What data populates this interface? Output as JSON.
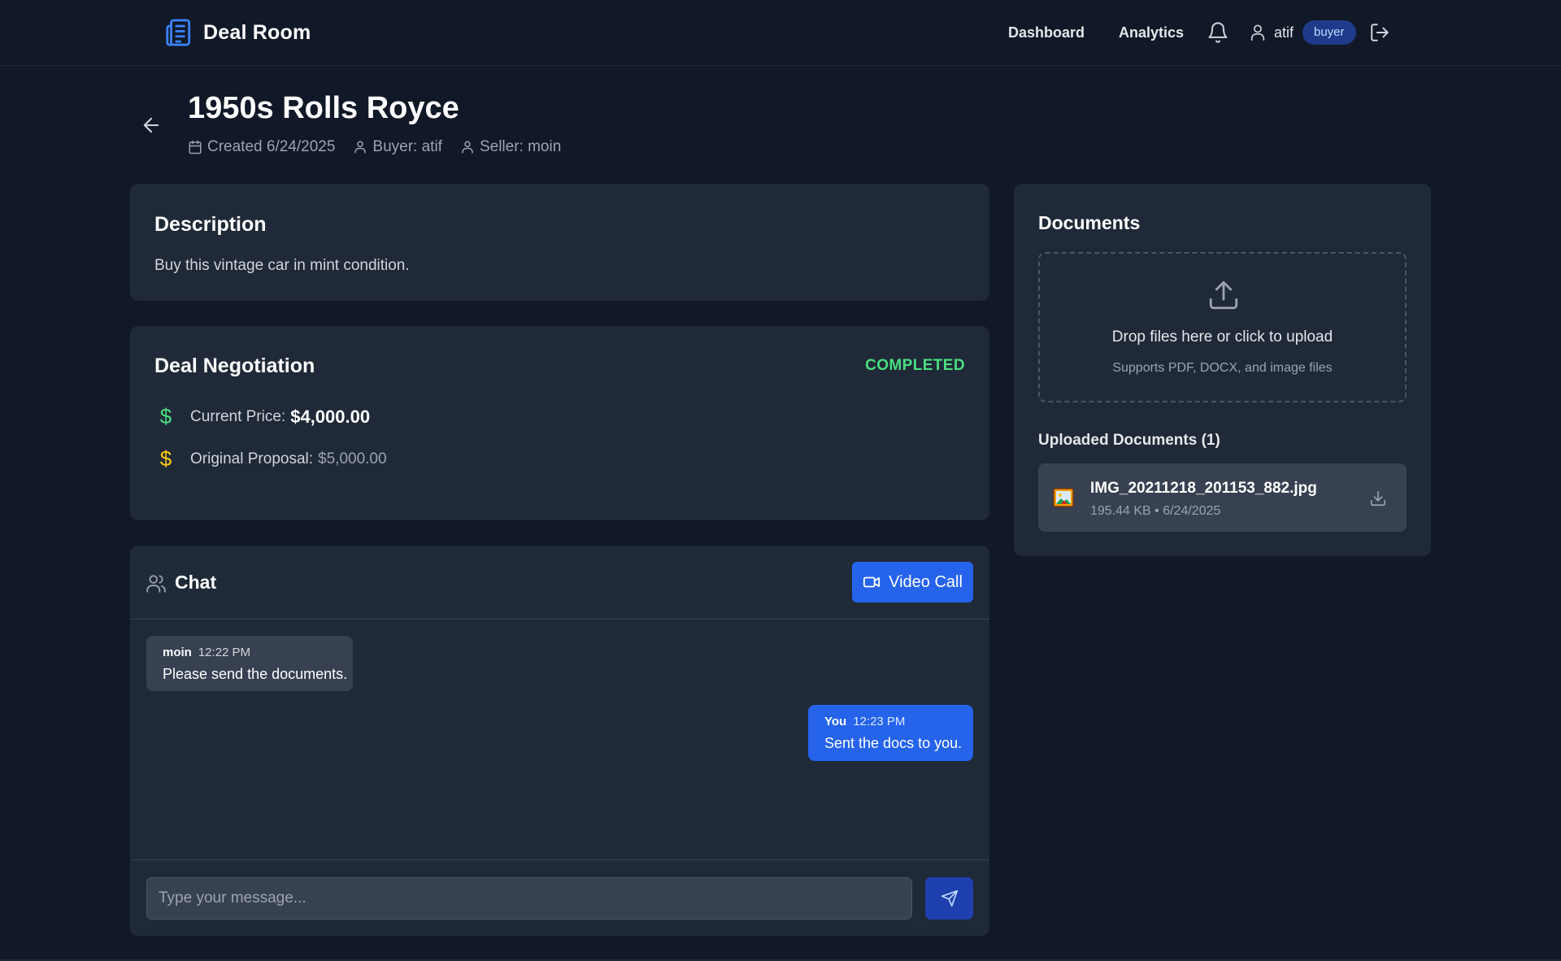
{
  "header": {
    "brand": "Deal Room",
    "brand_icon": "building-document-icon",
    "nav": [
      {
        "label": "Dashboard"
      },
      {
        "label": "Analytics"
      }
    ],
    "user_name": "atif",
    "role": "buyer"
  },
  "deal": {
    "title": "1950s Rolls Royce",
    "created": "Created 6/24/2025",
    "buyer": "Buyer: atif",
    "seller": "Seller: moin"
  },
  "description": {
    "title": "Description",
    "text": "Buy this vintage car in mint condition."
  },
  "negotiation": {
    "title": "Deal Negotiation",
    "status": "COMPLETED",
    "current_label": "Current Price:",
    "current_value": "$4,000.00",
    "original_label": "Original Proposal:",
    "original_value": "$5,000.00",
    "dollar_symbol": "$",
    "colors": {
      "current_icon": "#4ade80",
      "original_icon": "#facc15",
      "status": "#4ade80"
    }
  },
  "chat": {
    "title": "Chat",
    "video_call_label": "Video Call",
    "messages": [
      {
        "sender": "moin",
        "time": "12:22 PM",
        "text": "Please send the documents."
      },
      {
        "sender": "You",
        "time": "12:23 PM",
        "text": "Sent the docs to you."
      }
    ],
    "input_placeholder": "Type your message..."
  },
  "documents": {
    "title": "Documents",
    "drop_text": "Drop files here or click to upload",
    "drop_subtext": "Supports PDF, DOCX, and image files",
    "uploaded_heading": "Uploaded Documents (1)",
    "files": [
      {
        "name": "IMG_20211218_201153_882.jpg",
        "meta": "195.44 KB • 6/24/2025"
      }
    ]
  },
  "colors": {
    "background": "#111827",
    "card": "#1f2937",
    "accent": "#2563eb"
  }
}
